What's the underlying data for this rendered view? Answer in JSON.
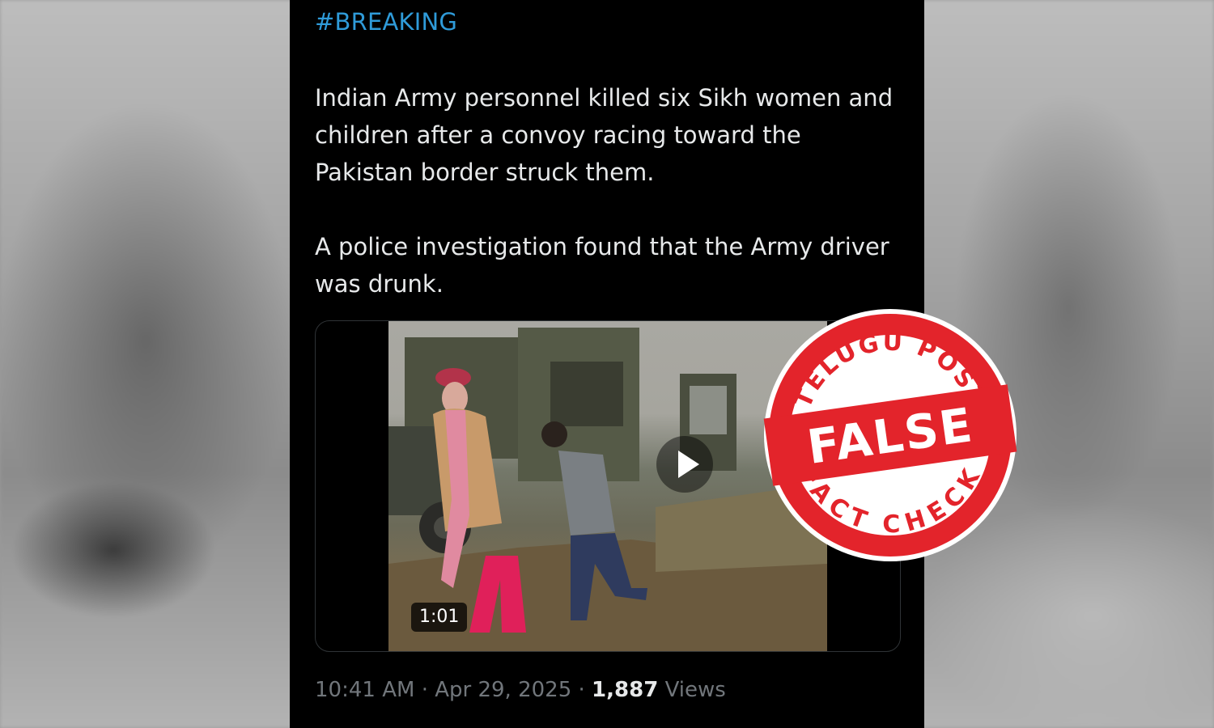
{
  "tweet": {
    "hashtag": "#BREAKING",
    "paragraph1": "Indian Army personnel killed six Sikh women and children after a convoy racing toward the Pakistan border struck them.",
    "paragraph2": "A police investigation found that the Army driver was drunk.",
    "video": {
      "duration": "1:01",
      "play_icon": "play-icon"
    },
    "time": "10:41 AM",
    "separator": "·",
    "date": "Apr 29, 2025",
    "views_count": "1,887",
    "views_label": "Views"
  },
  "stamp": {
    "top_text": "TELUGU POST",
    "verdict": "FALSE",
    "bottom_text": "FACT CHECK",
    "color": "#e3242b"
  },
  "colors": {
    "hashtag": "#2f9bd9",
    "text": "#e7e9ea",
    "muted": "#71767b",
    "background": "#000000"
  }
}
